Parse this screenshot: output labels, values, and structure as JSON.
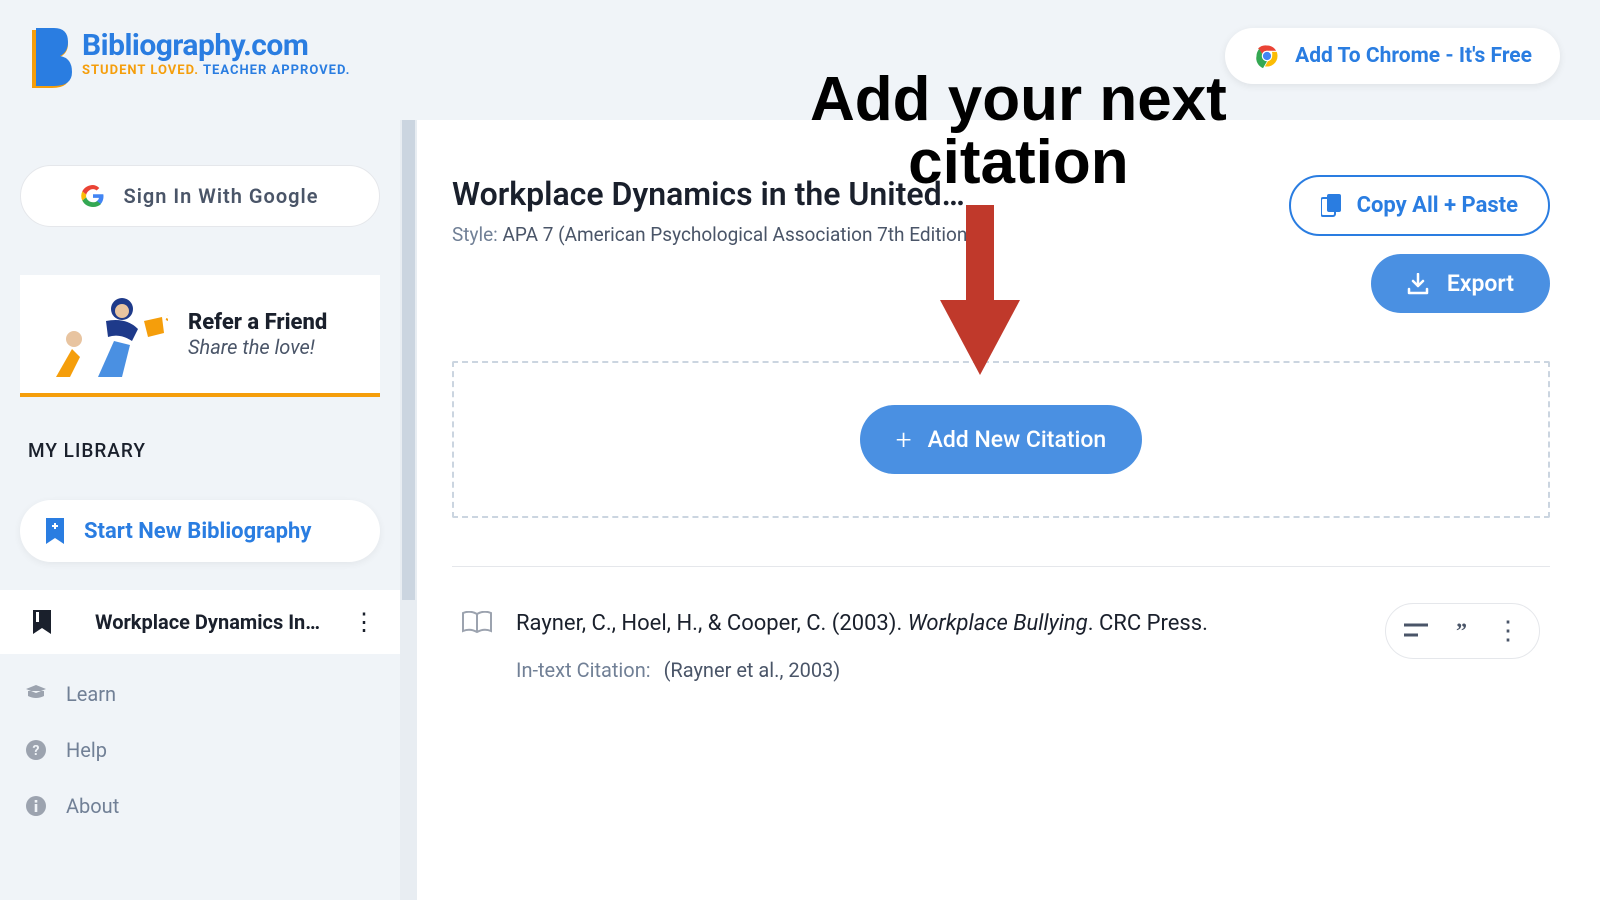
{
  "header": {
    "logo_title": "Bibliography.com",
    "logo_tag_a": "STUDENT LOVED. ",
    "logo_tag_b": "TEACHER APPROVED.",
    "chrome_label": "Add To Chrome - It's Free"
  },
  "sidebar": {
    "google_signin": "Sign In With Google",
    "refer_title": "Refer a Friend",
    "refer_sub": "Share the love!",
    "library_label": "MY LIBRARY",
    "start_new": "Start New Bibliography",
    "current_item": "Workplace Dynamics In …",
    "nav": {
      "learn": "Learn",
      "help": "Help",
      "about": "About"
    }
  },
  "main": {
    "title": "Workplace Dynamics in the United…",
    "style_label": "Style: ",
    "style_value": "APA 7 (American Psychological Association 7th Edition)",
    "copy_all": "Copy All + Paste",
    "export": "Export",
    "add_new": "Add New Citation",
    "citation": {
      "authors": "Rayner, C., Hoel, H., & Cooper, C. (2003). ",
      "title_italic": "Workplace Bullying",
      "tail": ". CRC Press.",
      "intext_label": "In-text Citation:",
      "intext_value": "(Rayner et al., 2003)"
    }
  },
  "annotation": {
    "line1": "Add your next",
    "line2": "citation"
  }
}
